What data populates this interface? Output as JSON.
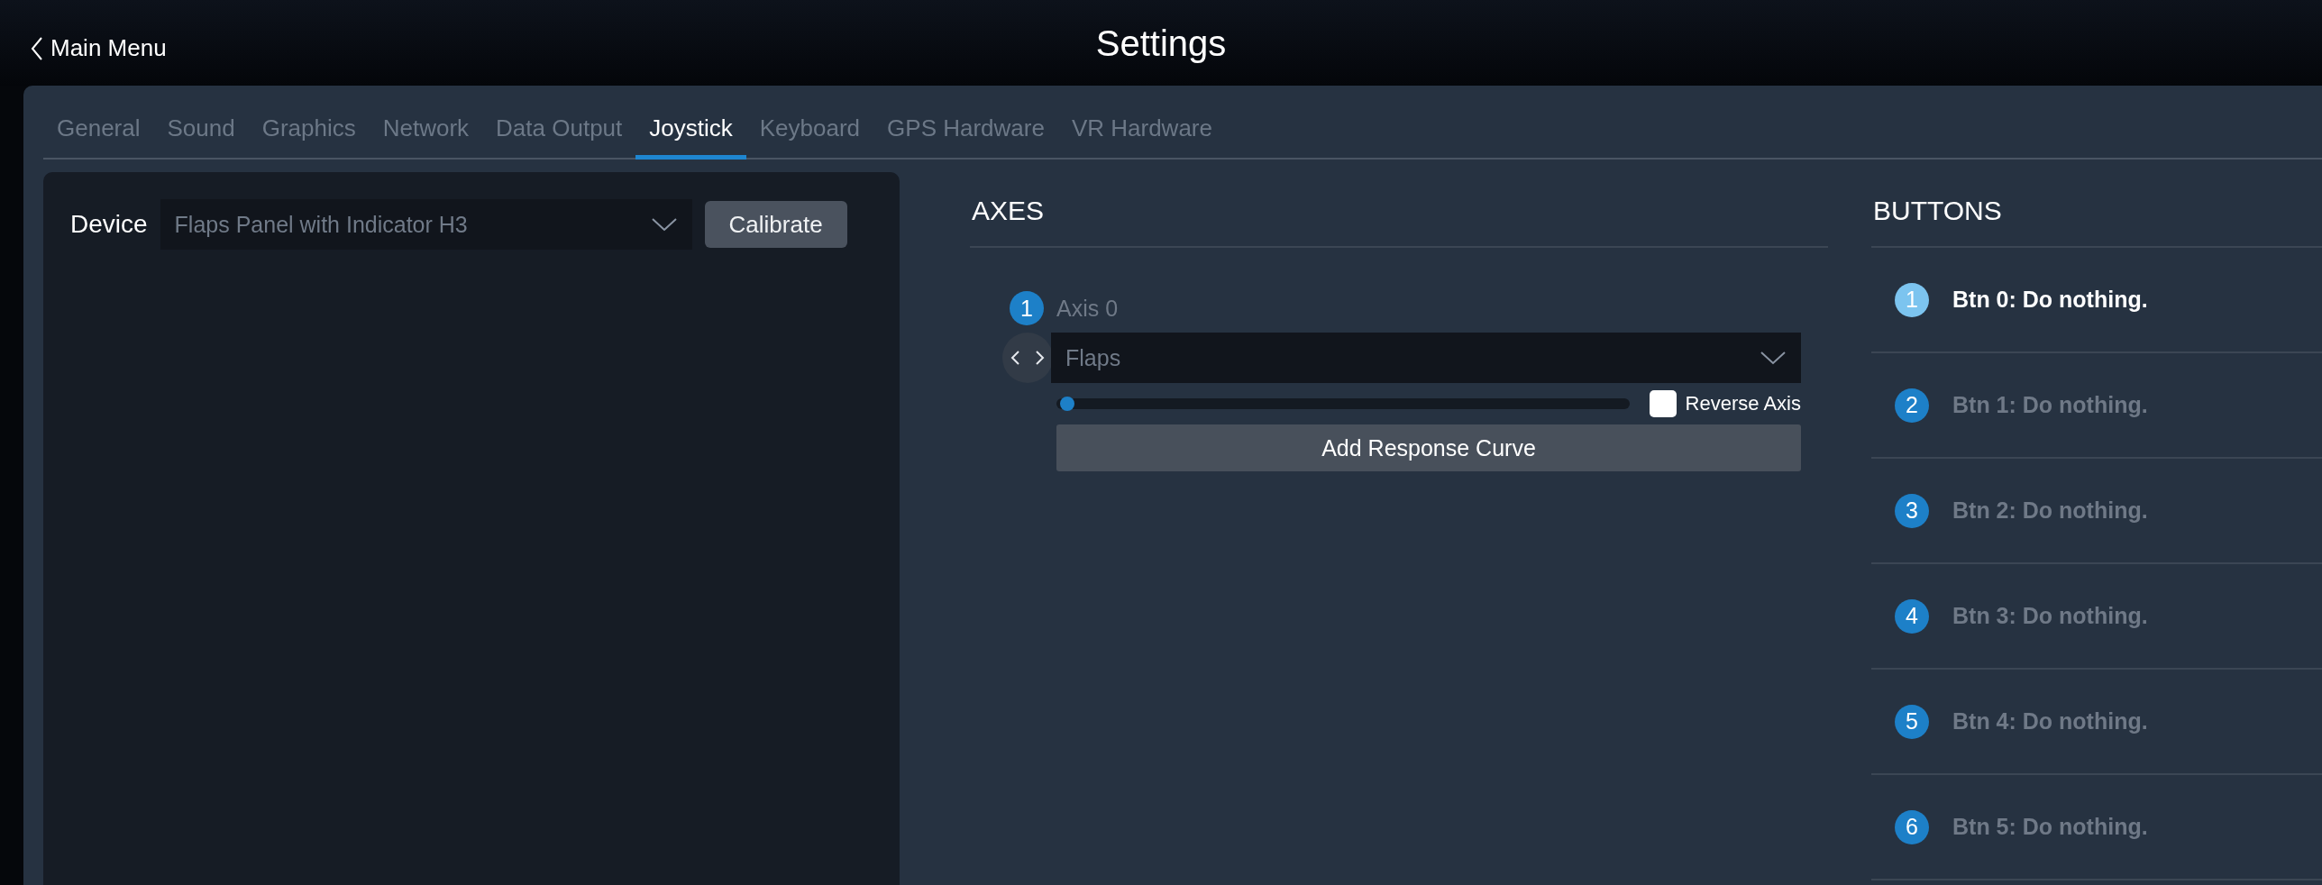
{
  "header": {
    "back_label": "Main Menu",
    "title": "Settings"
  },
  "tabs": [
    {
      "label": "General",
      "selected": false
    },
    {
      "label": "Sound",
      "selected": false
    },
    {
      "label": "Graphics",
      "selected": false
    },
    {
      "label": "Network",
      "selected": false
    },
    {
      "label": "Data Output",
      "selected": false
    },
    {
      "label": "Joystick",
      "selected": true
    },
    {
      "label": "Keyboard",
      "selected": false
    },
    {
      "label": "GPS Hardware",
      "selected": false
    },
    {
      "label": "VR Hardware",
      "selected": false
    }
  ],
  "device": {
    "label": "Device",
    "value": "Flaps Panel with Indicator H3",
    "calibrate_label": "Calibrate"
  },
  "axes": {
    "heading": "AXES",
    "items": [
      {
        "number": "1",
        "name": "Axis 0",
        "assignment": "Flaps",
        "level": 0.01,
        "reverse_label": "Reverse Axis",
        "reverse_checked": false,
        "curve_label": "Add Response Curve"
      }
    ]
  },
  "buttons": {
    "heading": "BUTTONS",
    "items": [
      {
        "number": "1",
        "label": "Btn 0: Do nothing.",
        "selected": true
      },
      {
        "number": "2",
        "label": "Btn 1: Do nothing.",
        "selected": false
      },
      {
        "number": "3",
        "label": "Btn 2: Do nothing.",
        "selected": false
      },
      {
        "number": "4",
        "label": "Btn 3: Do nothing.",
        "selected": false
      },
      {
        "number": "5",
        "label": "Btn 4: Do nothing.",
        "selected": false
      },
      {
        "number": "6",
        "label": "Btn 5: Do nothing.",
        "selected": false
      }
    ]
  }
}
